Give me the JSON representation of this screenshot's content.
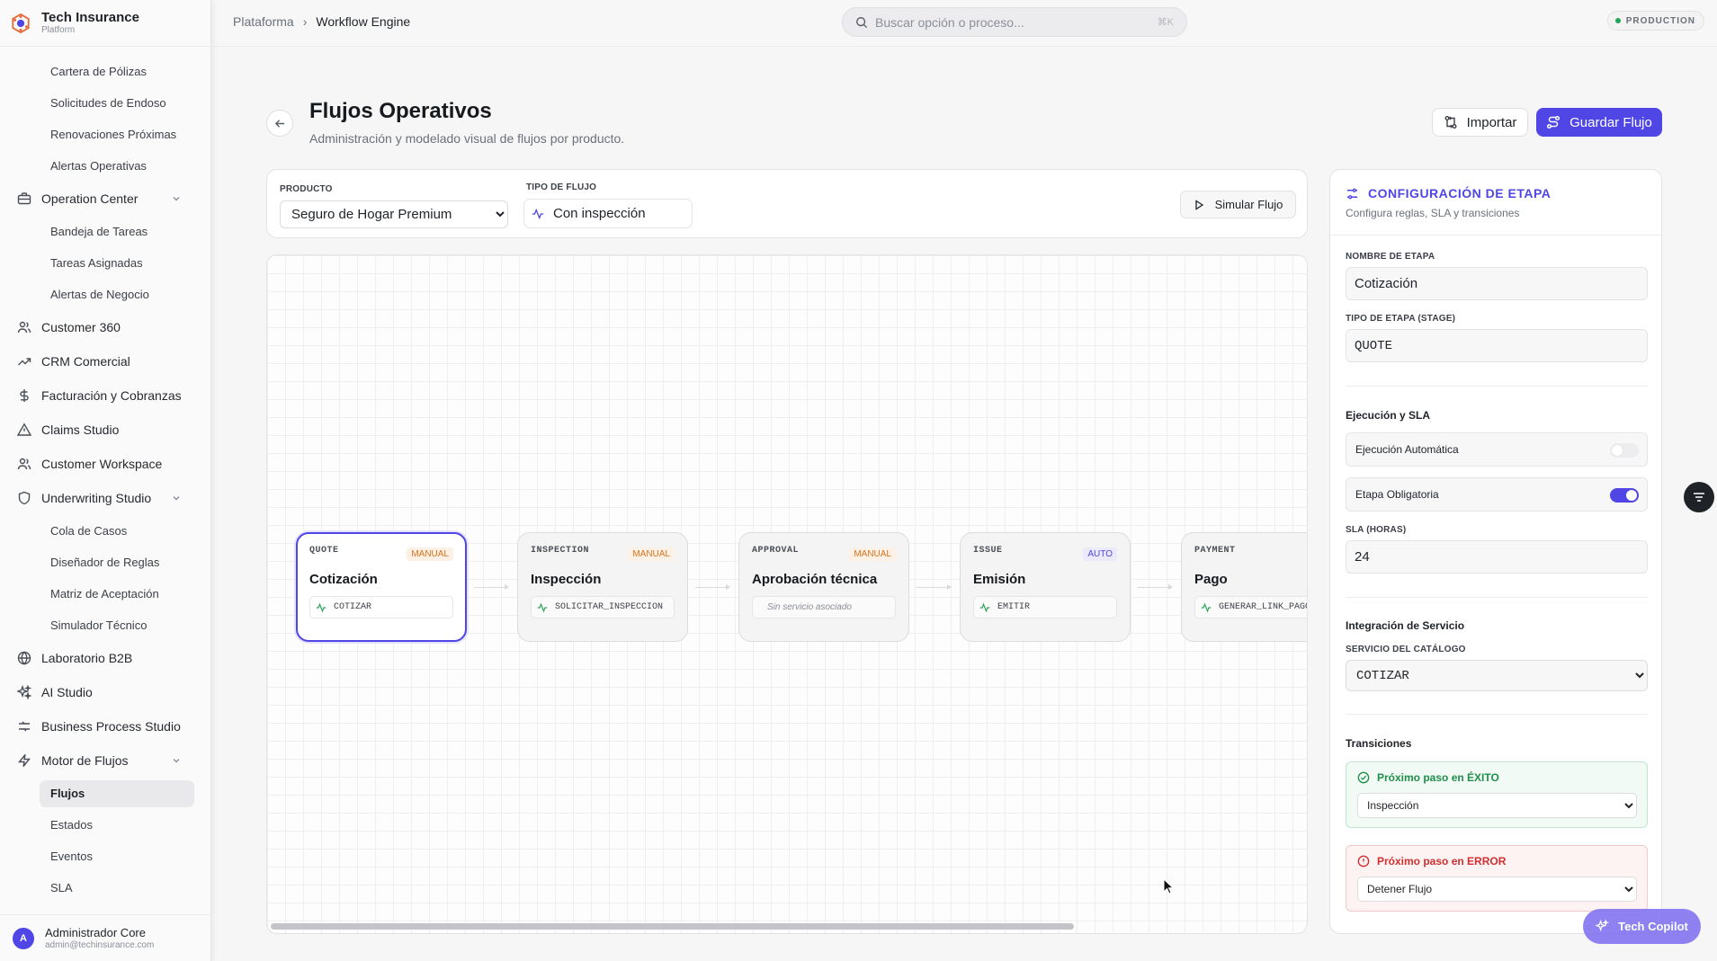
{
  "brand": {
    "title": "Tech Insurance",
    "subtitle": "Platform"
  },
  "sidebar": {
    "top_subitems": [
      "Cartera de Pólizas",
      "Solicitudes de Endoso",
      "Renovaciones Próximas",
      "Alertas Operativas"
    ],
    "operation_center": {
      "label": "Operation Center",
      "items": [
        "Bandeja de Tareas",
        "Tareas Asignadas",
        "Alertas de Negocio"
      ]
    },
    "customer_360": "Customer 360",
    "crm": "CRM Comercial",
    "billing": "Facturación y Cobranzas",
    "claims": "Claims Studio",
    "workspace": "Customer Workspace",
    "underwriting": {
      "label": "Underwriting Studio",
      "items": [
        "Cola de Casos",
        "Diseñador de Reglas",
        "Matriz de Aceptación",
        "Simulador Técnico"
      ]
    },
    "b2b": "Laboratorio B2B",
    "ai": "AI Studio",
    "bps": "Business Process Studio",
    "flow_engine": {
      "label": "Motor de Flujos",
      "items": [
        "Flujos",
        "Estados",
        "Eventos",
        "SLA"
      ],
      "active": "Flujos"
    }
  },
  "user": {
    "initial": "A",
    "name": "Administrador Core",
    "email": "admin@techinsurance.com"
  },
  "topbar": {
    "breadcrumb": [
      "Plataforma",
      "Workflow Engine"
    ],
    "search_placeholder": "Buscar opción o proceso...",
    "search_shortcut": "⌘K",
    "environment": "PRODUCTION"
  },
  "header": {
    "title": "Flujos Operativos",
    "subtitle": "Administración y modelado visual de flujos por producto.",
    "import_label": "Importar",
    "save_label": "Guardar Flujo"
  },
  "filters": {
    "product_label": "PRODUCTO",
    "product_value": "Seguro de Hogar Premium",
    "flow_type_label": "TIPO DE FLUJO",
    "flow_type_value": "Con inspección",
    "simulate_label": "Simular Flujo"
  },
  "flow": {
    "nodes": [
      {
        "stage": "QUOTE",
        "mode": "MANUAL",
        "name": "Cotización",
        "service": "COTIZAR"
      },
      {
        "stage": "INSPECTION",
        "mode": "MANUAL",
        "name": "Inspección",
        "service": "SOLICITAR_INSPECCION"
      },
      {
        "stage": "APPROVAL",
        "mode": "MANUAL",
        "name": "Aprobación técnica",
        "service": "Sin servicio asociado"
      },
      {
        "stage": "ISSUE",
        "mode": "AUTO",
        "name": "Emisión",
        "service": "EMITIR"
      },
      {
        "stage": "PAYMENT",
        "mode": "",
        "name": "Pago",
        "service": "GENERAR_LINK_PAGO"
      }
    ]
  },
  "config": {
    "title": "CONFIGURACIÓN DE ETAPA",
    "subtitle": "Configura reglas, SLA y transiciones",
    "stage_name_label": "NOMBRE DE ETAPA",
    "stage_name_value": "Cotización",
    "stage_type_label": "TIPO DE ETAPA (STAGE)",
    "stage_type_value": "QUOTE",
    "execution_section": "Ejecución y SLA",
    "auto_exec_label": "Ejecución Automática",
    "auto_exec_on": false,
    "mandatory_label": "Etapa Obligatoria",
    "mandatory_on": true,
    "sla_label": "SLA (HORAS)",
    "sla_value": "24",
    "integration_section": "Integración de Servicio",
    "catalog_label": "SERVICIO DEL CATÁLOGO",
    "catalog_value": "COTIZAR",
    "transitions_section": "Transiciones",
    "success_label": "Próximo paso en ÉXITO",
    "success_value": "Inspección",
    "error_label": "Próximo paso en ERROR",
    "error_value": "Detener Flujo"
  },
  "copilot_label": "Tech Copilot",
  "colors": {
    "accent": "#4f46e5",
    "success": "#1f8f4b",
    "error": "#d12f2f",
    "manual_badge": "#d9731f"
  }
}
